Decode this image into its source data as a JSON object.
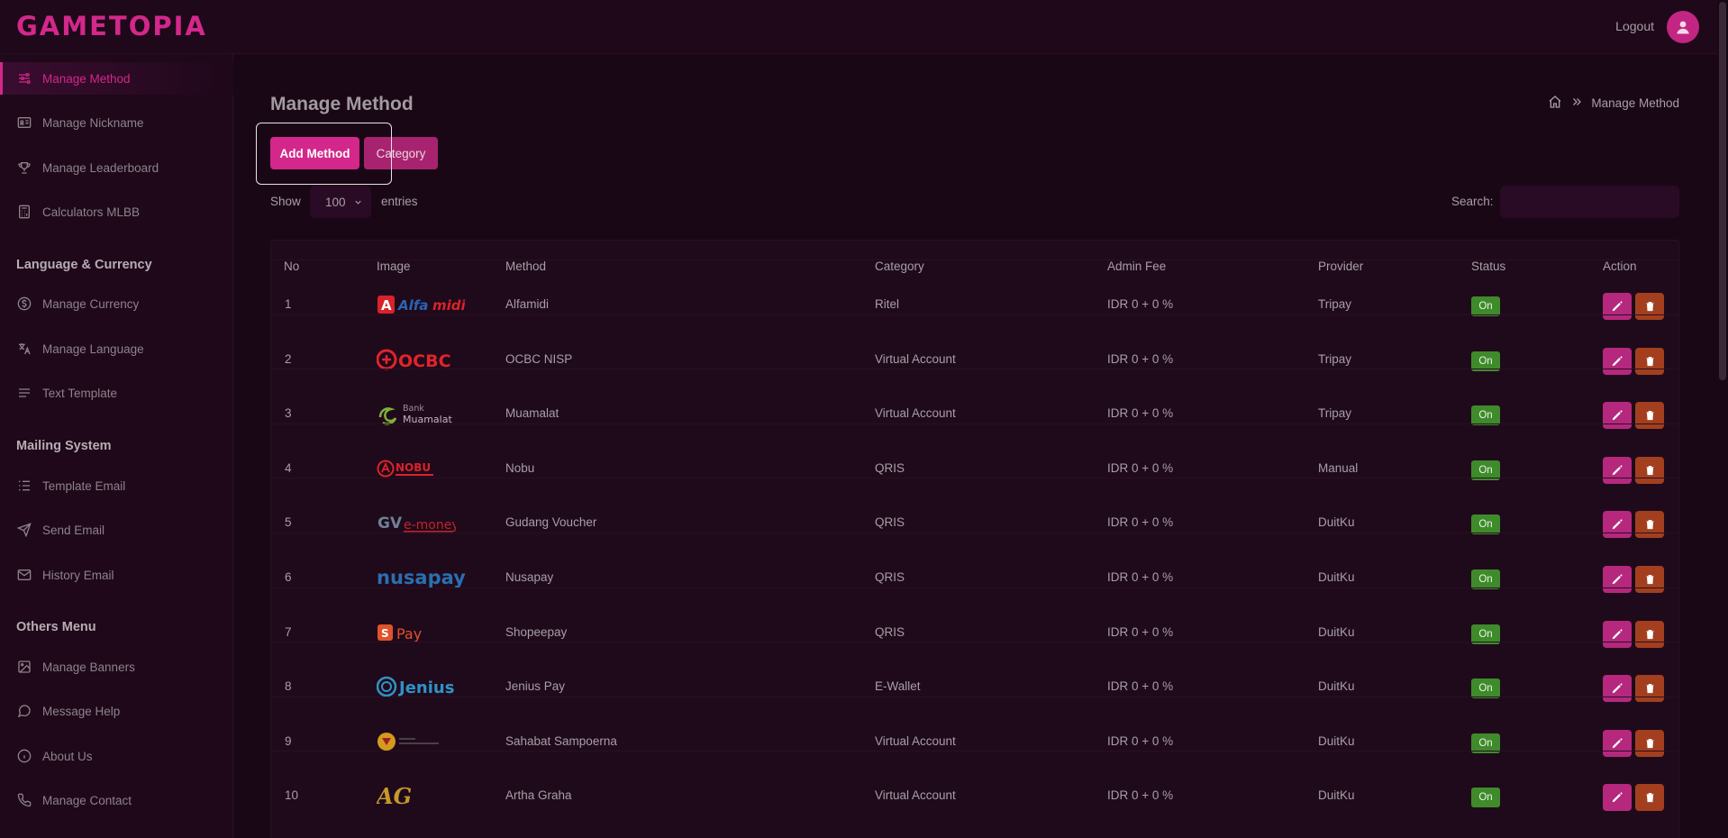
{
  "app": {
    "logo": "GAMETOPIA",
    "logout": "Logout"
  },
  "sidebar": {
    "items": [
      {
        "label": "Manage Method",
        "icon": "sliders-icon",
        "active": true
      },
      {
        "label": "Manage Nickname",
        "icon": "id-card-icon"
      },
      {
        "label": "Manage Leaderboard",
        "icon": "trophy-icon"
      },
      {
        "label": "Calculators MLBB",
        "icon": "calculator-icon"
      }
    ],
    "section_lang": "Language & Currency",
    "lang_items": [
      {
        "label": "Manage Currency",
        "icon": "dollar-circle-icon"
      },
      {
        "label": "Manage Language",
        "icon": "translate-icon"
      },
      {
        "label": "Text Template",
        "icon": "text-lines-icon"
      }
    ],
    "section_mail": "Mailing System",
    "mail_items": [
      {
        "label": "Template Email",
        "icon": "list-icon"
      },
      {
        "label": "Send Email",
        "icon": "send-icon"
      },
      {
        "label": "History Email",
        "icon": "envelope-icon"
      }
    ],
    "section_others": "Others Menu",
    "other_items": [
      {
        "label": "Manage Banners",
        "icon": "image-icon"
      },
      {
        "label": "Message Help",
        "icon": "chat-icon"
      },
      {
        "label": "About Us",
        "icon": "info-icon"
      },
      {
        "label": "Manage Contact",
        "icon": "phone-icon"
      }
    ]
  },
  "main": {
    "title": "Manage Method",
    "breadcrumb": {
      "current": "Manage Method"
    },
    "add_button": "Add Method",
    "category_button": "Category",
    "show_label": "Show",
    "entries_value": "100",
    "entries_label": "entries",
    "search_label": "Search:",
    "search_placeholder": ""
  },
  "table": {
    "headers": [
      "No",
      "Image",
      "Method",
      "Category",
      "Admin Fee",
      "Provider",
      "Status",
      "Action"
    ],
    "rows": [
      {
        "no": "1",
        "logo": "Alfamidi",
        "method": "Alfamidi",
        "category": "Ritel",
        "fee": "IDR 0 + 0 %",
        "provider": "Tripay",
        "status": "On"
      },
      {
        "no": "2",
        "logo": "OCBC",
        "method": "OCBC NISP",
        "category": "Virtual Account",
        "fee": "IDR 0 + 0 %",
        "provider": "Tripay",
        "status": "On"
      },
      {
        "no": "3",
        "logo": "Bank Muamalat",
        "method": "Muamalat",
        "category": "Virtual Account",
        "fee": "IDR 0 + 0 %",
        "provider": "Tripay",
        "status": "On"
      },
      {
        "no": "4",
        "logo": "NOBU",
        "method": "Nobu",
        "category": "QRIS",
        "fee": "IDR 0 + 0 %",
        "provider": "Manual",
        "status": "On"
      },
      {
        "no": "5",
        "logo": "GVe-money",
        "method": "Gudang Voucher",
        "category": "QRIS",
        "fee": "IDR 0 + 0 %",
        "provider": "DuitKu",
        "status": "On"
      },
      {
        "no": "6",
        "logo": "nusapay",
        "method": "Nusapay",
        "category": "QRIS",
        "fee": "IDR 0 + 0 %",
        "provider": "DuitKu",
        "status": "On"
      },
      {
        "no": "7",
        "logo": "Pay",
        "method": "Shopeepay",
        "category": "QRIS",
        "fee": "IDR 0 + 0 %",
        "provider": "DuitKu",
        "status": "On"
      },
      {
        "no": "8",
        "logo": "Jenius",
        "method": "Jenius Pay",
        "category": "E-Wallet",
        "fee": "IDR 0 + 0 %",
        "provider": "DuitKu",
        "status": "On"
      },
      {
        "no": "9",
        "logo": "",
        "method": "Sahabat Sampoerna",
        "category": "Virtual Account",
        "fee": "IDR 0 + 0 %",
        "provider": "DuitKu",
        "status": "On"
      },
      {
        "no": "10",
        "logo": "AG",
        "method": "Artha Graha",
        "category": "Virtual Account",
        "fee": "IDR 0 + 0 %",
        "provider": "DuitKu",
        "status": "On"
      }
    ]
  },
  "colors": {
    "accent": "#d3278b",
    "status_on": "#3f8b2b",
    "delete": "#a33f1e",
    "background": "#1a0716"
  }
}
